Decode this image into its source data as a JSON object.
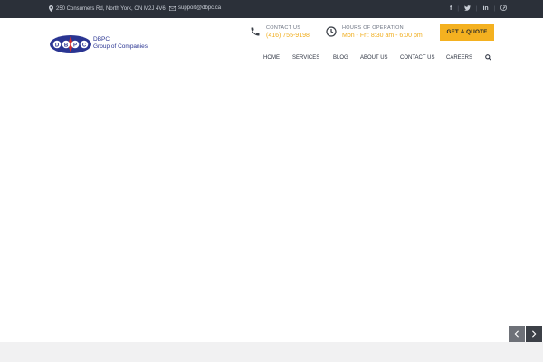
{
  "topbar": {
    "address": "250 Consumers Rd, North York, ON M2J 4V6",
    "email": "support@dbpc.ca",
    "social": [
      {
        "icon": "facebook-icon",
        "glyph": "f"
      },
      {
        "icon": "twitter-icon",
        "glyph": "t"
      },
      {
        "icon": "linkedin-icon",
        "glyph": "in"
      },
      {
        "icon": "pinterest-icon",
        "glyph": "p"
      }
    ]
  },
  "brand": {
    "logo_letters": [
      "D",
      "B",
      "P",
      "C"
    ],
    "line1": "DBPC",
    "line2": "Group of Companies"
  },
  "contact": {
    "label": "CONTACT US",
    "value": "(416) 755-9198"
  },
  "hours": {
    "label": "HOURS OF OPERATION",
    "value": "Mon - Fri: 8:30 am - 6:00 pm"
  },
  "cta": {
    "label": "GET A QUOTE"
  },
  "nav": {
    "items": [
      "HOME",
      "SERVICES",
      "BLOG",
      "ABOUT US",
      "CONTACT US",
      "CAREERS"
    ]
  },
  "slider": {
    "prev_icon": "chevron-left-icon",
    "next_icon": "chevron-right-icon"
  },
  "colors": {
    "topbar": "#2b3039",
    "accent": "#f4b120",
    "brand_blue": "#2a3592",
    "brand_red": "#d32f2f"
  }
}
